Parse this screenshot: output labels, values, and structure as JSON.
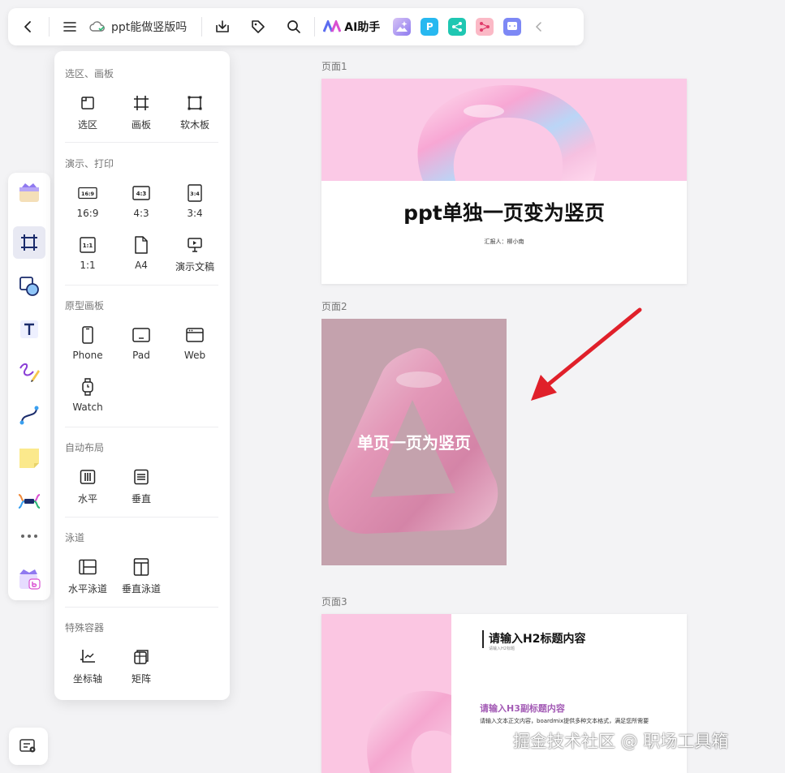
{
  "toolbar": {
    "doc_title": "ppt能做竖版吗",
    "ai_label": "AI助手",
    "plugin_p_label": "P"
  },
  "panel": {
    "sections": [
      {
        "title": "选区、画板",
        "items": [
          "选区",
          "画板",
          "软木板"
        ]
      },
      {
        "title": "演示、打印",
        "items": [
          "16:9",
          "4:3",
          "3:4",
          "1:1",
          "A4",
          "演示文稿"
        ]
      },
      {
        "title": "原型画板",
        "items": [
          "Phone",
          "Pad",
          "Web",
          "Watch"
        ]
      },
      {
        "title": "自动布局",
        "items": [
          "水平",
          "垂直"
        ]
      },
      {
        "title": "泳道",
        "items": [
          "水平泳道",
          "垂直泳道"
        ]
      },
      {
        "title": "特殊容器",
        "items": [
          "坐标轴",
          "矩阵"
        ]
      }
    ],
    "ratio_badges": {
      "r169": "16:9",
      "r43": "4:3",
      "r34": "3:4",
      "r11": "1:1"
    }
  },
  "canvas": {
    "pages": [
      {
        "label": "页面1",
        "title": "ppt单独一页变为竖页",
        "subtitle": "汇报人：柳小南"
      },
      {
        "label": "页面2",
        "title": "单页一页为竖页"
      },
      {
        "label": "页面3",
        "h2": "请输入H2标题内容",
        "h2_sub": "请输入H2标题",
        "h3": "请输入H3副标题内容",
        "body": "请输入文本正文内容，boardmix提供多种文本格式，满足您所需要"
      }
    ]
  },
  "watermark": "掘金技术社区 @ 职场工具箱",
  "colors": {
    "accent": "#e8e9f3",
    "arrow": "#e0202a",
    "page2_bg": "#c4a2ad",
    "hero_pink": "#fbc9e6"
  }
}
